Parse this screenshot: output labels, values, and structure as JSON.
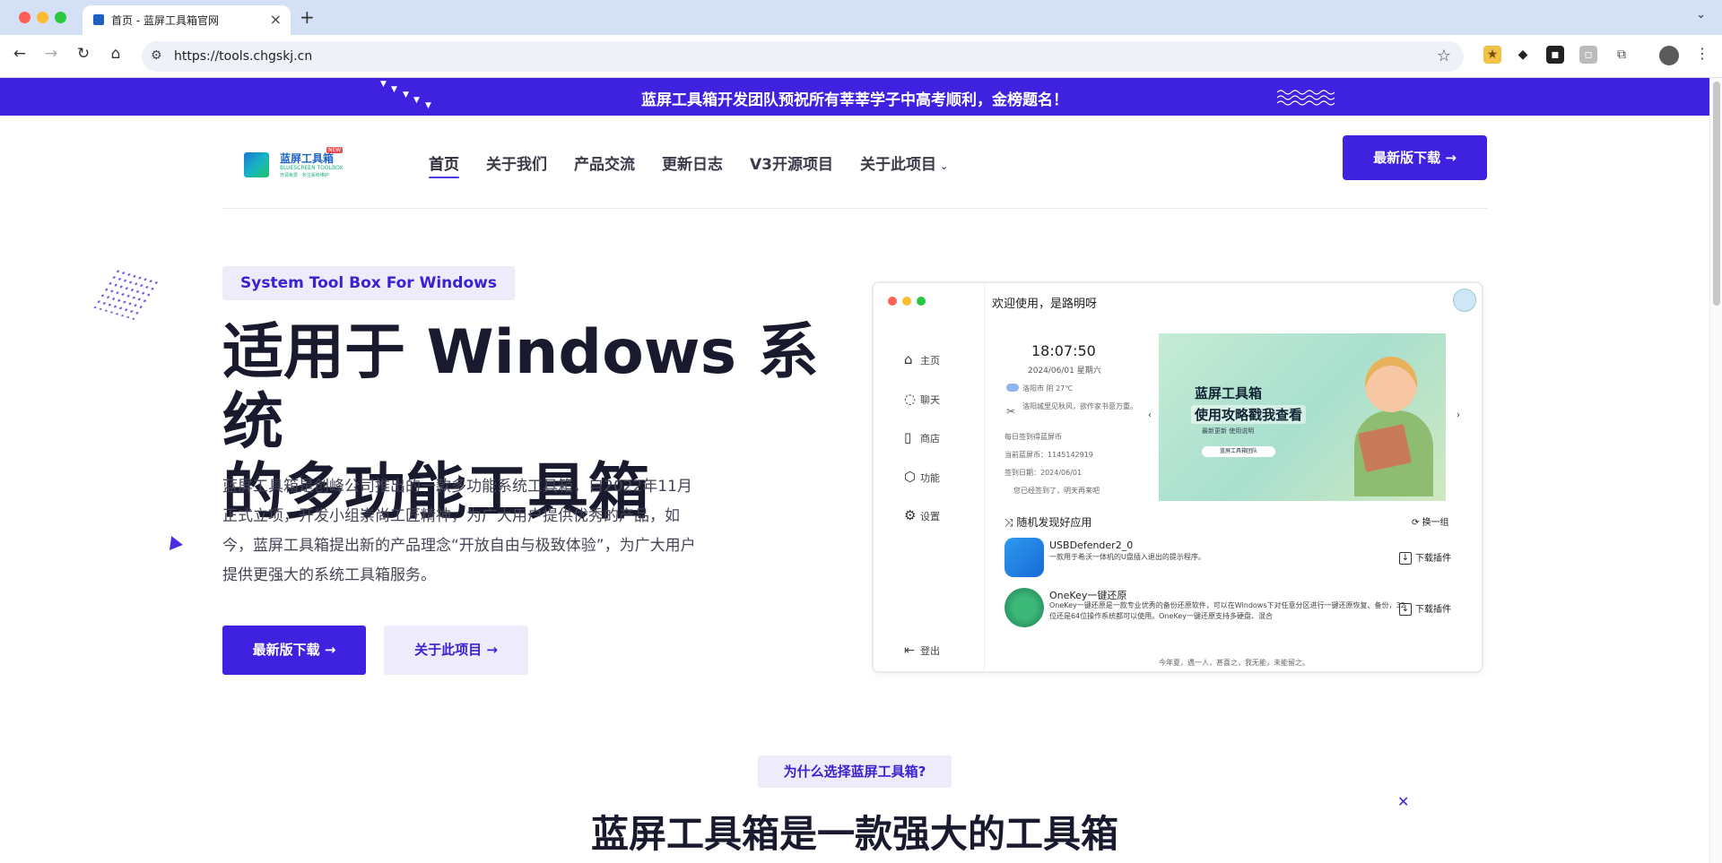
{
  "browser": {
    "tab_title": "首页 - 蓝屏工具箱官网",
    "url": "https://tools.chgskj.cn"
  },
  "banner": {
    "text": "蓝屏工具箱开发团队预祝所有莘莘学子中高考顺利，金榜题名！"
  },
  "header": {
    "logo_title": "蓝屏工具箱",
    "logo_badge": "NEW",
    "logo_sub": "BLUESCREEN TOOLBOX",
    "logo_sub2": "开源免费 · 专注系统维护",
    "nav": {
      "home": "首页",
      "about_us": "关于我们",
      "product": "产品交流",
      "changelog": "更新日志",
      "v3": "V3开源项目",
      "about_project": "关于此项目"
    },
    "download_label": "最新版下载 →"
  },
  "hero": {
    "tag": "System Tool Box For Windows",
    "title_line1": "适用于 Windows 系统",
    "title_line2": "的多功能工具箱",
    "description": "蓝屏工具箱是创峰公司推出的一款多功能系统工具箱，自2022年11月正式立项，开发小组崇尚工匠精神，为广大用户提供优秀的产品，如今，蓝屏工具箱提出新的产品理念“开放自由与极致体验”，为广大用户提供更强大的系统工具箱服务。",
    "btn_download": "最新版下载 →",
    "btn_about": "关于此项目 →"
  },
  "app_preview": {
    "welcome": "欢迎使用，是路明呀",
    "sidebar": [
      "主页",
      "聊天",
      "商店",
      "功能",
      "设置"
    ],
    "logout": "登出",
    "time": "18:07:50",
    "date": "2024/06/01 星期六",
    "weather": "洛阳市 阴 27℃",
    "notice": "洛阳城里见秋风，欲作家书意万重。",
    "checkin_title": "每日签到得蓝屏币",
    "coins": "当前蓝屏币：1145142919",
    "checkin_date": "签到日期：2024/06/01",
    "checkin_msg": "您已经签到了，明天再来吧",
    "carousel_title1": "蓝屏工具箱",
    "carousel_title2": "使用攻略戳我查看",
    "carousel_sub": "最新更新  使用说明",
    "carousel_pill": "蓝屏工具箱团队",
    "random_title": "随机发现好应用",
    "swap": "换一组",
    "apps": [
      {
        "name": "USBDefender2_0",
        "desc": "一款用于希沃一体机的U盘插入退出的提示程序。",
        "action": "下载插件"
      },
      {
        "name": "OneKey一键还原",
        "desc": "OneKey一键还原是一款专业优秀的备份还原软件，可以在Windows下对任意分区进行一键还原恢复、备份，32位还是64位操作系统都可以使用。OneKey一键还原支持多硬盘、混合",
        "action": "下载插件"
      }
    ],
    "footer": "今年夏，遇一人，甚喜之，我无能，未能留之。"
  },
  "section2": {
    "tag": "为什么选择蓝屏工具箱?",
    "title": "蓝屏工具箱是一款强大的工具箱"
  },
  "colors": {
    "accent": "#3f21e0",
    "accent_light": "#eeebfb",
    "text_dark": "#1a1a2e"
  }
}
